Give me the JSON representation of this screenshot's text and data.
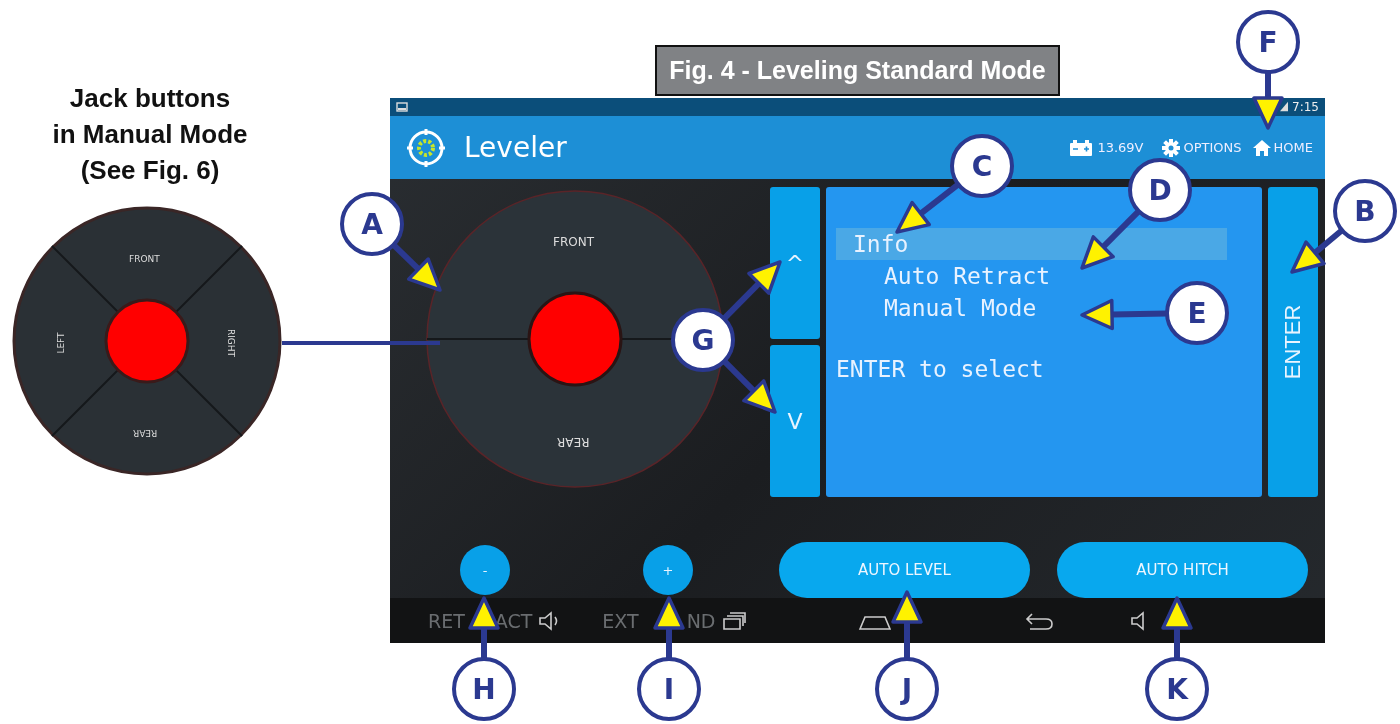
{
  "figure_title": "Fig. 4 - Leveling Standard Mode",
  "side_panel": {
    "heading_lines": [
      "Jack buttons",
      "in Manual Mode",
      "(See Fig. 6)"
    ],
    "jack_labels": {
      "front": "FRONT",
      "right": "RIGHT",
      "rear": "REAR",
      "left": "LEFT"
    }
  },
  "screen": {
    "status_bar": {
      "time": "7:15"
    },
    "app_bar": {
      "title": "Leveler",
      "battery_voltage": "13.69V",
      "options": "OPTIONS",
      "home": "HOME"
    },
    "joystick": {
      "front": "FRONT",
      "rear": "REAR"
    },
    "up_button": "^",
    "down_button": "V",
    "menu": {
      "items": [
        {
          "label": "Info",
          "selected": true,
          "children": [
            {
              "label": "Auto Retract",
              "selected": false
            },
            {
              "label": "Manual Mode",
              "selected": false
            }
          ]
        }
      ],
      "prompt": "ENTER to select"
    },
    "enter_button": "ENTER",
    "bottom_buttons": [
      {
        "kind": "round",
        "label": "-"
      },
      {
        "kind": "round",
        "label": "+"
      },
      {
        "kind": "pill",
        "label": "AUTO LEVEL"
      },
      {
        "kind": "pill",
        "label": "AUTO HITCH"
      }
    ],
    "nav_bar": {
      "labels": [
        "RET",
        "ACT",
        "EXT",
        "ND"
      ]
    }
  },
  "callouts": [
    {
      "letter": "A"
    },
    {
      "letter": "B"
    },
    {
      "letter": "C"
    },
    {
      "letter": "D"
    },
    {
      "letter": "E"
    },
    {
      "letter": "F"
    },
    {
      "letter": "G"
    },
    {
      "letter": "H"
    },
    {
      "letter": "I"
    },
    {
      "letter": "J"
    },
    {
      "letter": "K"
    }
  ]
}
